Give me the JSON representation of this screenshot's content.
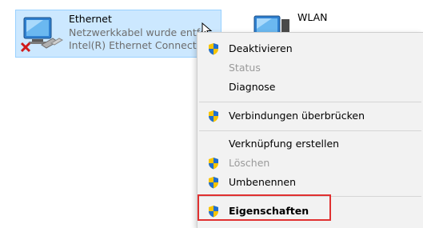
{
  "adapters": [
    {
      "name": "Ethernet",
      "status": "Netzwerkkabel wurde entfe",
      "device": "Intel(R) Ethernet Connection"
    },
    {
      "name": "WLAN",
      "status": "",
      "device": ""
    }
  ],
  "context_menu": {
    "items": [
      {
        "label": "Deaktivieren",
        "shield": true,
        "enabled": true
      },
      {
        "label": "Status",
        "shield": false,
        "enabled": false
      },
      {
        "label": "Diagnose",
        "shield": false,
        "enabled": true
      },
      {
        "label": "Verbindungen überbrücken",
        "shield": true,
        "enabled": true
      },
      {
        "label": "Verknüpfung erstellen",
        "shield": false,
        "enabled": true
      },
      {
        "label": "Löschen",
        "shield": true,
        "enabled": false
      },
      {
        "label": "Umbenennen",
        "shield": true,
        "enabled": true
      },
      {
        "label": "Eigenschaften",
        "shield": true,
        "enabled": true,
        "default": true
      }
    ]
  },
  "colors": {
    "selection_bg": "#cce8ff",
    "selection_border": "#99d1ff",
    "menu_bg": "#f2f2f2",
    "highlight_box": "#e03131",
    "shield_blue": "#1f6fd1",
    "shield_yellow": "#f7c400"
  }
}
